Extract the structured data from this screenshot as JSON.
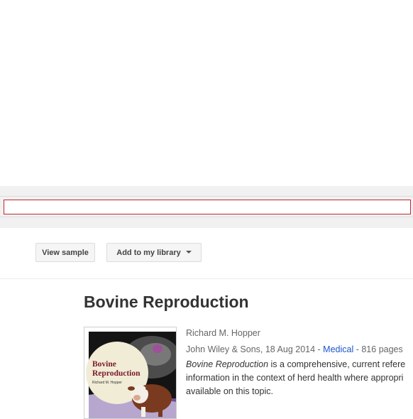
{
  "search": {
    "value": "",
    "placeholder": ""
  },
  "toolbar": {
    "view_sample_label": "View sample",
    "add_library_label": "Add to my library"
  },
  "book": {
    "title": "Bovine Reproduction",
    "author": "Richard M. Hopper",
    "publisher_date": "John Wiley & Sons, 18 Aug 2014",
    "separator1": " - ",
    "category": "Medical",
    "separator2": " - ",
    "pages": "816 pages",
    "description_title": "Bovine Reproduction",
    "description_line1": " is a comprehensive, current refere",
    "description_line2": "information in the context of herd health where appropri",
    "description_line3": "available on this topic.",
    "cover": {
      "title_line1": "Bovine",
      "title_line2": "Reproduction",
      "author": "Richard M. Hopper"
    }
  },
  "colors": {
    "search_border": "#c0282d",
    "link": "#1a55c9",
    "band": "#f1f1f1",
    "cover_title": "#7a1a2a"
  },
  "icons": {
    "dropdown": "caret-down-icon"
  }
}
